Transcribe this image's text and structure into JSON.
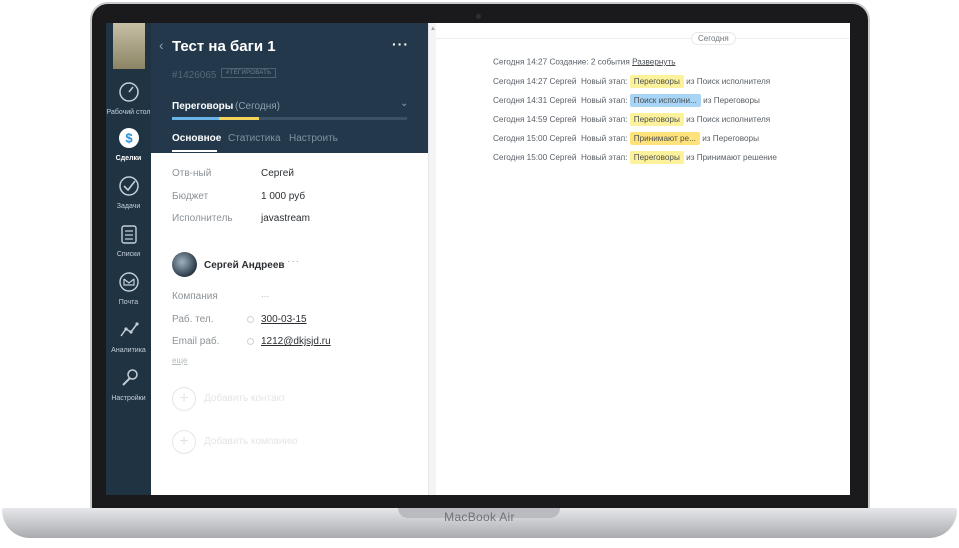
{
  "device": {
    "brand": "MacBook Air"
  },
  "nav": {
    "items": [
      {
        "label": "Рабочий стол",
        "icon": "dashboard-icon"
      },
      {
        "label": "Сделки",
        "icon": "deals-icon",
        "active": true
      },
      {
        "label": "Задачи",
        "icon": "tasks-icon"
      },
      {
        "label": "Списки",
        "icon": "lists-icon"
      },
      {
        "label": "Почта",
        "icon": "mail-icon"
      },
      {
        "label": "Аналитика",
        "icon": "analytics-icon"
      },
      {
        "label": "Настройки",
        "icon": "settings-icon"
      }
    ]
  },
  "card": {
    "title": "Тест на баги 1",
    "more": "···",
    "deal_id": "#1426065",
    "tag_button": "#ТЕГИРОВАТЬ",
    "stage": {
      "name": "Переговоры",
      "date": "(Сегодня)",
      "progress_blue": 0.2,
      "progress_yellow": 0.17
    },
    "tabs": [
      "Основное",
      "Статистика",
      "Настроить"
    ],
    "fields": [
      {
        "label": "Отв-ный",
        "value": "Сергей"
      },
      {
        "label": "Бюджет",
        "value": "1 000 руб"
      },
      {
        "label": "Исполнитель",
        "value": "javastream"
      }
    ],
    "contact": {
      "name": "Сергей Андреев",
      "dots": "···",
      "fields": [
        {
          "label": "Компания",
          "value": "..."
        },
        {
          "label": "Раб. тел.",
          "value": "300-03-15"
        },
        {
          "label": "Email раб.",
          "value": "1212@dkjsjd.ru"
        }
      ],
      "more_link": "еще"
    },
    "add_contact": "Добавить контакт",
    "add_company": "Добавить компанию"
  },
  "feed": {
    "date_chip": "Сегодня",
    "header": {
      "time": "Сегодня 14:27",
      "text": "Создание: 2 события",
      "link": "Развернуть"
    },
    "rows": [
      {
        "time": "Сегодня 14:27",
        "user": "Сергей",
        "action": "Новый этап:",
        "stage": "Переговоры",
        "color": "yellow",
        "from": "из Поиск исполнителя"
      },
      {
        "time": "Сегодня 14:31",
        "user": "Сергей",
        "action": "Новый этап:",
        "stage": "Поиск исполни...",
        "color": "blue",
        "from": "из Переговоры"
      },
      {
        "time": "Сегодня 14:59",
        "user": "Сергей",
        "action": "Новый этап:",
        "stage": "Переговоры",
        "color": "yellow",
        "from": "из Поиск исполнителя"
      },
      {
        "time": "Сегодня 15:00",
        "user": "Сергей",
        "action": "Новый этап:",
        "stage": "Принимают ре...",
        "color": "orange",
        "from": "из Переговоры"
      },
      {
        "time": "Сегодня 15:00",
        "user": "Сергей",
        "action": "Новый этап:",
        "stage": "Переговоры",
        "color": "yellow",
        "from": "из Принимают решение"
      }
    ]
  }
}
